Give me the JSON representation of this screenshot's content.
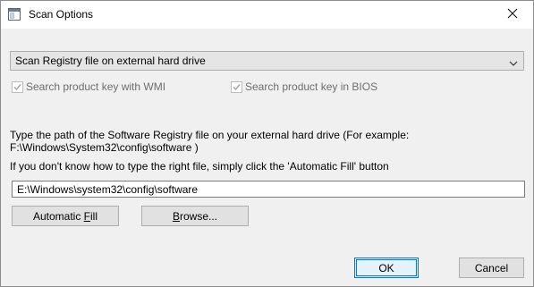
{
  "window": {
    "title": "Scan Options",
    "close_glyph": "✕",
    "icons": {
      "app": "window-icon",
      "close": "close-icon"
    }
  },
  "scan_source": {
    "selected": "Scan Registry file on external hard drive",
    "arrow": "chevron-down-icon"
  },
  "options": {
    "wmi": {
      "label": "Search product key with WMI",
      "checked": true,
      "enabled": false
    },
    "bios": {
      "label": "Search product key in BIOS",
      "checked": true,
      "enabled": false
    }
  },
  "instructions": {
    "line1": "Type the path of the Software Registry file on your external hard drive (For example:",
    "line2": "F:\\Windows\\System32\\config\\software )",
    "line3": "If you don't know how to type the right file, simply click the 'Automatic Fill' button"
  },
  "path_field": {
    "value": "E:\\Windows\\system32\\config\\software"
  },
  "buttons": {
    "auto_fill_prefix": "Automatic ",
    "auto_fill_mnemonic": "F",
    "auto_fill_suffix": "ill",
    "browse_mnemonic": "B",
    "browse_suffix": "rowse...",
    "ok": "OK",
    "cancel": "Cancel"
  },
  "colors": {
    "dialog_bg": "#f0f0f0",
    "titlebar_bg": "#ffffff",
    "focus_border": "#0078d7",
    "disabled_text": "#6d6d6d"
  }
}
